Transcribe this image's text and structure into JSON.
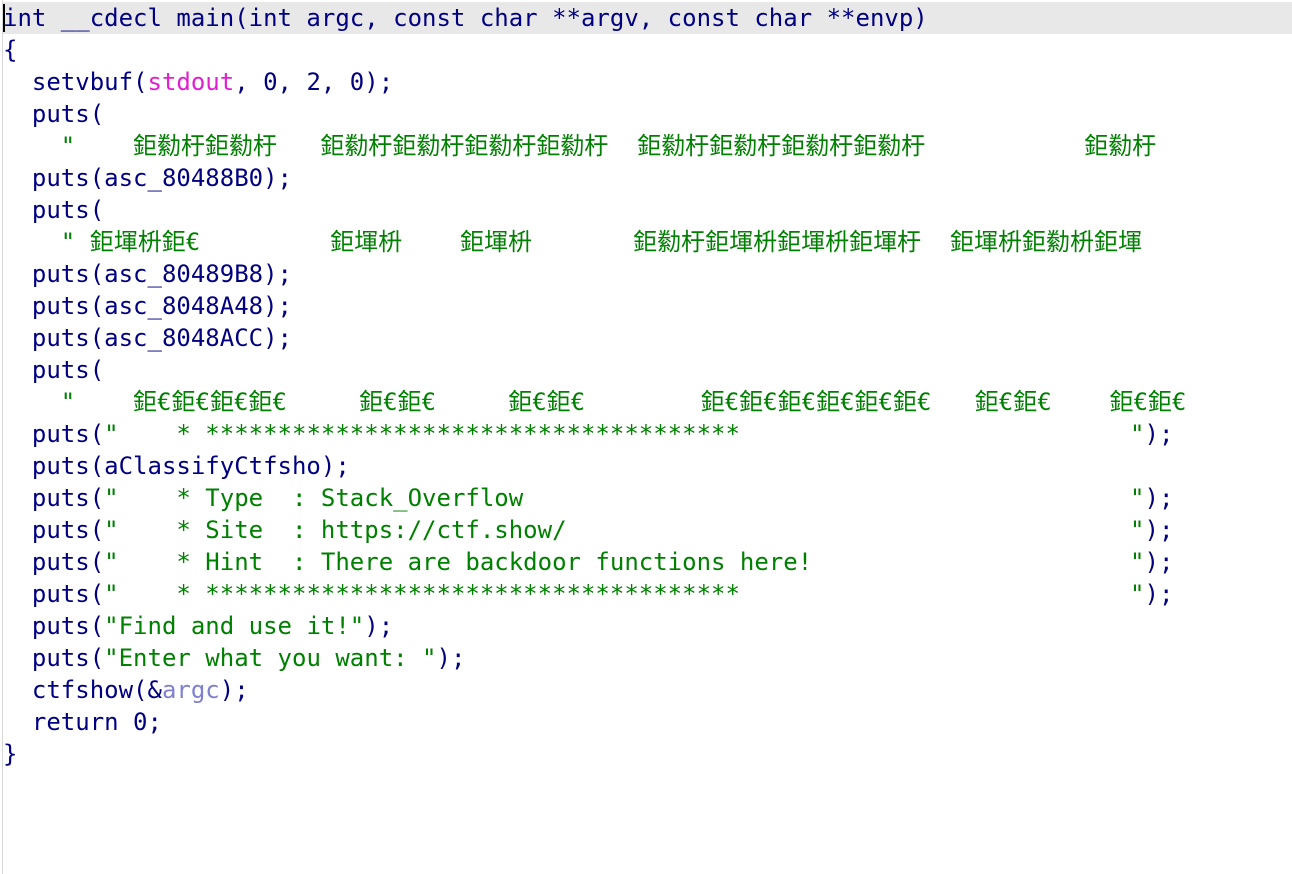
{
  "code_lines": [
    [
      {
        "t": "int __cdecl main(int argc, const char **argv, const char **envp)",
        "c": "pln"
      }
    ],
    [
      {
        "t": "{",
        "c": "pln"
      }
    ],
    [
      {
        "t": "  setvbuf(",
        "c": "pln"
      },
      {
        "t": "stdout",
        "c": "glb"
      },
      {
        "t": ", 0, 2, 0);",
        "c": "pln"
      }
    ],
    [
      {
        "t": "  puts(",
        "c": "pln"
      }
    ],
    [
      {
        "t": "    \"    鉅勬杅鉅勬杅   鉅勬杅鉅勬杅鉅勬杅鉅勬杅  鉅勬杅鉅勬杅鉅勬杅鉅勬杅           鉅勬杅",
        "c": "str"
      }
    ],
    [
      {
        "t": "  puts(asc_80488B0);",
        "c": "pln"
      }
    ],
    [
      {
        "t": "  puts(",
        "c": "pln"
      }
    ],
    [
      {
        "t": "    \" 鉅堚枡鉅€         鉅堚枡    鉅堚枡       鉅勬杅鉅堚枡鉅堚枡鉅堚杅  鉅堚枡鉅勬枡鉅堚",
        "c": "str"
      }
    ],
    [
      {
        "t": "  puts(asc_80489B8);",
        "c": "pln"
      }
    ],
    [
      {
        "t": "  puts(asc_8048A48);",
        "c": "pln"
      }
    ],
    [
      {
        "t": "  puts(asc_8048ACC);",
        "c": "pln"
      }
    ],
    [
      {
        "t": "  puts(",
        "c": "pln"
      }
    ],
    [
      {
        "t": "    \"    鉅€鉅€鉅€鉅€     鉅€鉅€     鉅€鉅€        鉅€鉅€鉅€鉅€鉅€鉅€   鉅€鉅€    鉅€鉅€",
        "c": "str"
      }
    ],
    [
      {
        "t": "  puts(",
        "c": "pln"
      },
      {
        "t": "\"    * *************************************                           \"",
        "c": "str"
      },
      {
        "t": ");",
        "c": "pln"
      }
    ],
    [
      {
        "t": "  puts(aClassifyCtfsho);",
        "c": "pln"
      }
    ],
    [
      {
        "t": "  puts(",
        "c": "pln"
      },
      {
        "t": "\"    * Type  : Stack_Overflow                                          \"",
        "c": "str"
      },
      {
        "t": ");",
        "c": "pln"
      }
    ],
    [
      {
        "t": "  puts(",
        "c": "pln"
      },
      {
        "t": "\"    * Site  : https://ctf.show/                                       \"",
        "c": "str"
      },
      {
        "t": ");",
        "c": "pln"
      }
    ],
    [
      {
        "t": "  puts(",
        "c": "pln"
      },
      {
        "t": "\"    * Hint  : There are backdoor functions here!                      \"",
        "c": "str"
      },
      {
        "t": ");",
        "c": "pln"
      }
    ],
    [
      {
        "t": "  puts(",
        "c": "pln"
      },
      {
        "t": "\"    * *************************************                           \"",
        "c": "str"
      },
      {
        "t": ");",
        "c": "pln"
      }
    ],
    [
      {
        "t": "  puts(",
        "c": "pln"
      },
      {
        "t": "\"Find and use it!\"",
        "c": "str"
      },
      {
        "t": ");",
        "c": "pln"
      }
    ],
    [
      {
        "t": "  puts(",
        "c": "pln"
      },
      {
        "t": "\"Enter what you want: \"",
        "c": "str"
      },
      {
        "t": ");",
        "c": "pln"
      }
    ],
    [
      {
        "t": "  ctfshow(&",
        "c": "pln"
      },
      {
        "t": "argc",
        "c": "var"
      },
      {
        "t": ");",
        "c": "pln"
      }
    ],
    [
      {
        "t": "  return 0;",
        "c": "pln"
      }
    ],
    [
      {
        "t": "}",
        "c": "pln"
      }
    ]
  ]
}
